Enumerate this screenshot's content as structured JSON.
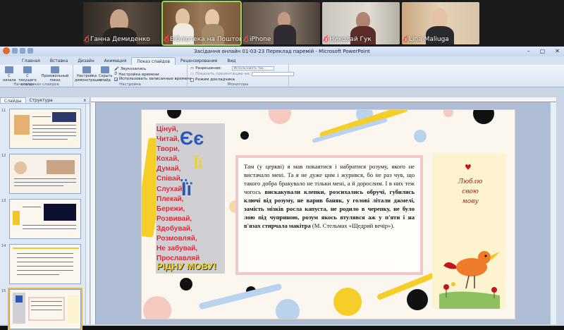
{
  "video_tiles": [
    {
      "name": "Ганна Демиденко"
    },
    {
      "name": "Бібліотека на Поштовій"
    },
    {
      "name": "iPhone"
    },
    {
      "name": "Николай Гук"
    },
    {
      "name": "Lina Maliuga"
    }
  ],
  "window": {
    "title": "Засідання онлайн 01-03-23 Переклад паремій - Microsoft PowerPoint"
  },
  "ribbon_tabs": [
    "Главная",
    "Вставка",
    "Дизайн",
    "Анимация",
    "Показ слайдов",
    "Рецензирование",
    "Вид"
  ],
  "ribbon": {
    "group1": {
      "name": "Начать показ слайдов",
      "buttons": [
        "С начала",
        "С текущего слайда",
        "Произвольный показ"
      ]
    },
    "group2": {
      "name": "Настройка",
      "buttons": [
        "Настройка демонстрации",
        "Скрыть слайд"
      ],
      "lines": [
        "Звукозапись",
        "Настройка времени",
        "Использовать записанные времена"
      ]
    },
    "group3": {
      "name": "Мониторы",
      "resolution_label": "Разрешение:",
      "resolution_value": "Использовать тек...",
      "show_on_label": "Показать презентацию на:",
      "presenter_mode": "Режим докладчика"
    }
  },
  "left_pane": {
    "tab_slides": "Слайды",
    "tab_outline": "Структура",
    "close": "x",
    "slide_numbers": [
      "11",
      "12",
      "13",
      "14",
      "15"
    ]
  },
  "slide": {
    "cyr_words": [
      "Цінуй,",
      "Читай,",
      "Твори,",
      "Кохай,",
      "Думай,",
      "Співай,",
      "Слухай,",
      "Плекай,",
      "Бережи,",
      "Розвивай,",
      "Здобувай,",
      "Розмовляй,",
      "Не забувай,",
      "Прославляй"
    ],
    "cyr_big1": "Єє",
    "cyr_big2": "Її",
    "cyr_big3": "Її",
    "cyr_footer": "РІДНУ МОВУ!",
    "text_part1": "Там (у церкві) я мав покаятися і набратися розуму, якого не вистачало мені. Та я не дуже цим і журився, бо не раз чув, що такого добра бракувало не тільки мені, а й дорослим. І в них теж чогось ",
    "text_bold": "вискакували клепки, розсихались обручі, губились ключі від розуму, не варив баняк, у голові літали джмелі, замість мізків росла капуста, не родило в черепку, не було лою під чуприною, розум якось втулявся аж у п'яти і на в'язах стирчала макітра",
    "text_part2": " (М. Стельмах «Щедрий вечір»).",
    "card_text": [
      "Люблю",
      "свою",
      "мову"
    ]
  },
  "colors": {
    "accent_red": "#d7222e",
    "accent_blue": "#2d57b5",
    "accent_yellow": "#f3d21a",
    "ribbon_bg": "#dae5f4"
  }
}
